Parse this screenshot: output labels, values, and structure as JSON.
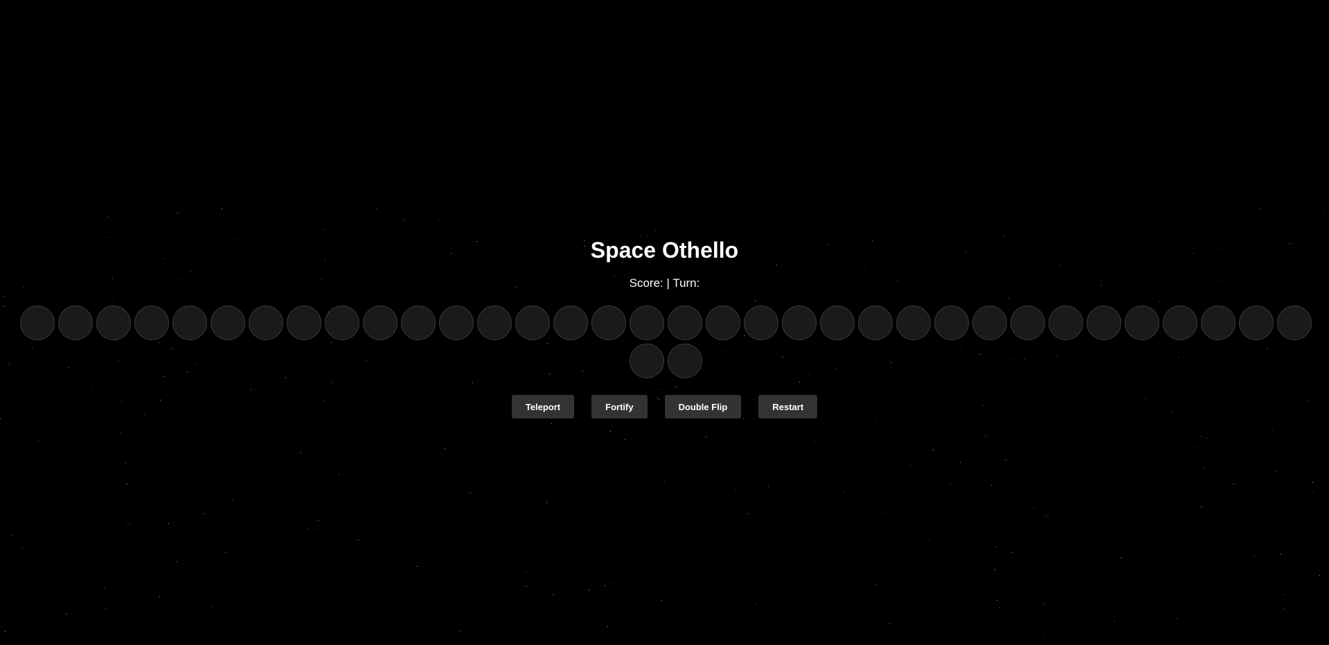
{
  "game": {
    "title": "Space Othello",
    "status": "Score: | Turn:"
  },
  "board": {
    "cell_count": 36,
    "cells": [
      "",
      "",
      "",
      "",
      "",
      "",
      "",
      "",
      "",
      "",
      "",
      "",
      "",
      "",
      "",
      "",
      "",
      "",
      "",
      "",
      "",
      "",
      "",
      "",
      "",
      "",
      "",
      "",
      "",
      "",
      "",
      "",
      "",
      "",
      "",
      ""
    ]
  },
  "controls": {
    "teleport_label": "Teleport",
    "fortify_label": "Fortify",
    "double_flip_label": "Double Flip",
    "restart_label": "Restart"
  },
  "colors": {
    "background": "#000000",
    "cell_fill": "#1a1a1a",
    "cell_border": "#3a3a3a",
    "button_bg": "#333333",
    "text": "#ffffff"
  }
}
